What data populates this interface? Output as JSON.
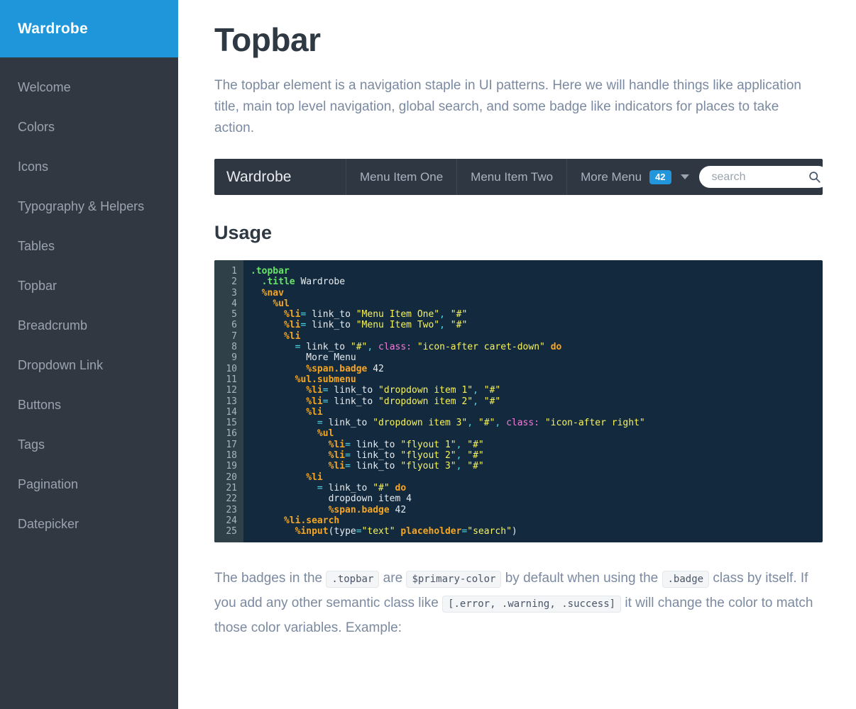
{
  "sidebar": {
    "brand": "Wardrobe",
    "items": [
      {
        "label": "Welcome"
      },
      {
        "label": "Colors"
      },
      {
        "label": "Icons"
      },
      {
        "label": "Typography & Helpers"
      },
      {
        "label": "Tables"
      },
      {
        "label": "Topbar"
      },
      {
        "label": "Breadcrumb"
      },
      {
        "label": "Dropdown Link"
      },
      {
        "label": "Buttons"
      },
      {
        "label": "Tags"
      },
      {
        "label": "Pagination"
      },
      {
        "label": "Datepicker"
      }
    ],
    "brand_bg": "#1f96d9",
    "bg": "#313841",
    "item_color": "#9aa4b0"
  },
  "page": {
    "title": "Topbar",
    "intro": "The topbar element is a navigation staple in UI patterns. Here we will handle things like application title, main top level navigation, global search, and some badge like indicators for places to take action.",
    "usage_heading": "Usage"
  },
  "topbar_demo": {
    "title": "Wardrobe",
    "menu_items": [
      {
        "label": "Menu Item One"
      },
      {
        "label": "Menu Item Two"
      }
    ],
    "more_menu": {
      "label": "More Menu",
      "badge": "42",
      "caret_icon": "caret-down-icon"
    },
    "search": {
      "value": "",
      "placeholder": "search",
      "icon": "search-icon"
    },
    "bg": "#2f3742",
    "badge_color": "#2196dd"
  },
  "code_block": {
    "language": "haml",
    "first_line": 1,
    "last_line": 25,
    "line_numbers": [
      "1",
      "2",
      "3",
      "4",
      "5",
      "6",
      "7",
      "8",
      "9",
      "10",
      "11",
      "12",
      "13",
      "14",
      "15",
      "16",
      "17",
      "18",
      "19",
      "20",
      "21",
      "22",
      "23",
      "24",
      "25"
    ],
    "lines": [
      ".topbar",
      "  .title Wardrobe",
      "  %nav",
      "    %ul",
      "      %li= link_to \"Menu Item One\", \"#\"",
      "      %li= link_to \"Menu Item Two\", \"#\"",
      "      %li",
      "        = link_to \"#\", class: \"icon-after caret-down\" do",
      "          More Menu",
      "          %span.badge 42",
      "        %ul.submenu",
      "          %li= link_to \"dropdown item 1\", \"#\"",
      "          %li= link_to \"dropdown item 2\", \"#\"",
      "          %li",
      "            = link_to \"dropdown item 3\", \"#\", class: \"icon-after right\"",
      "            %ul",
      "              %li= link_to \"flyout 1\", \"#\"",
      "              %li= link_to \"flyout 2\", \"#\"",
      "              %li= link_to \"flyout 3\", \"#\"",
      "          %li",
      "            = link_to \"#\" do",
      "              dropdown item 4",
      "              %span.badge 42",
      "      %li.search",
      "        %input(type=\"text\" placeholder=\"search\")"
    ],
    "bg": "#13293d",
    "gutter_bg": "#2f4049"
  },
  "outro": {
    "part1": "The badges in the ",
    "chip1": ".topbar",
    "part2": " are ",
    "chip2": "$primary-color",
    "part3": " by default when using the ",
    "chip3": ".badge",
    "part4": " class by itself. If you add any other semantic class like ",
    "chip4": "[.error, .warning, .success]",
    "part5": " it will change the color to match those color variables. Example:"
  }
}
